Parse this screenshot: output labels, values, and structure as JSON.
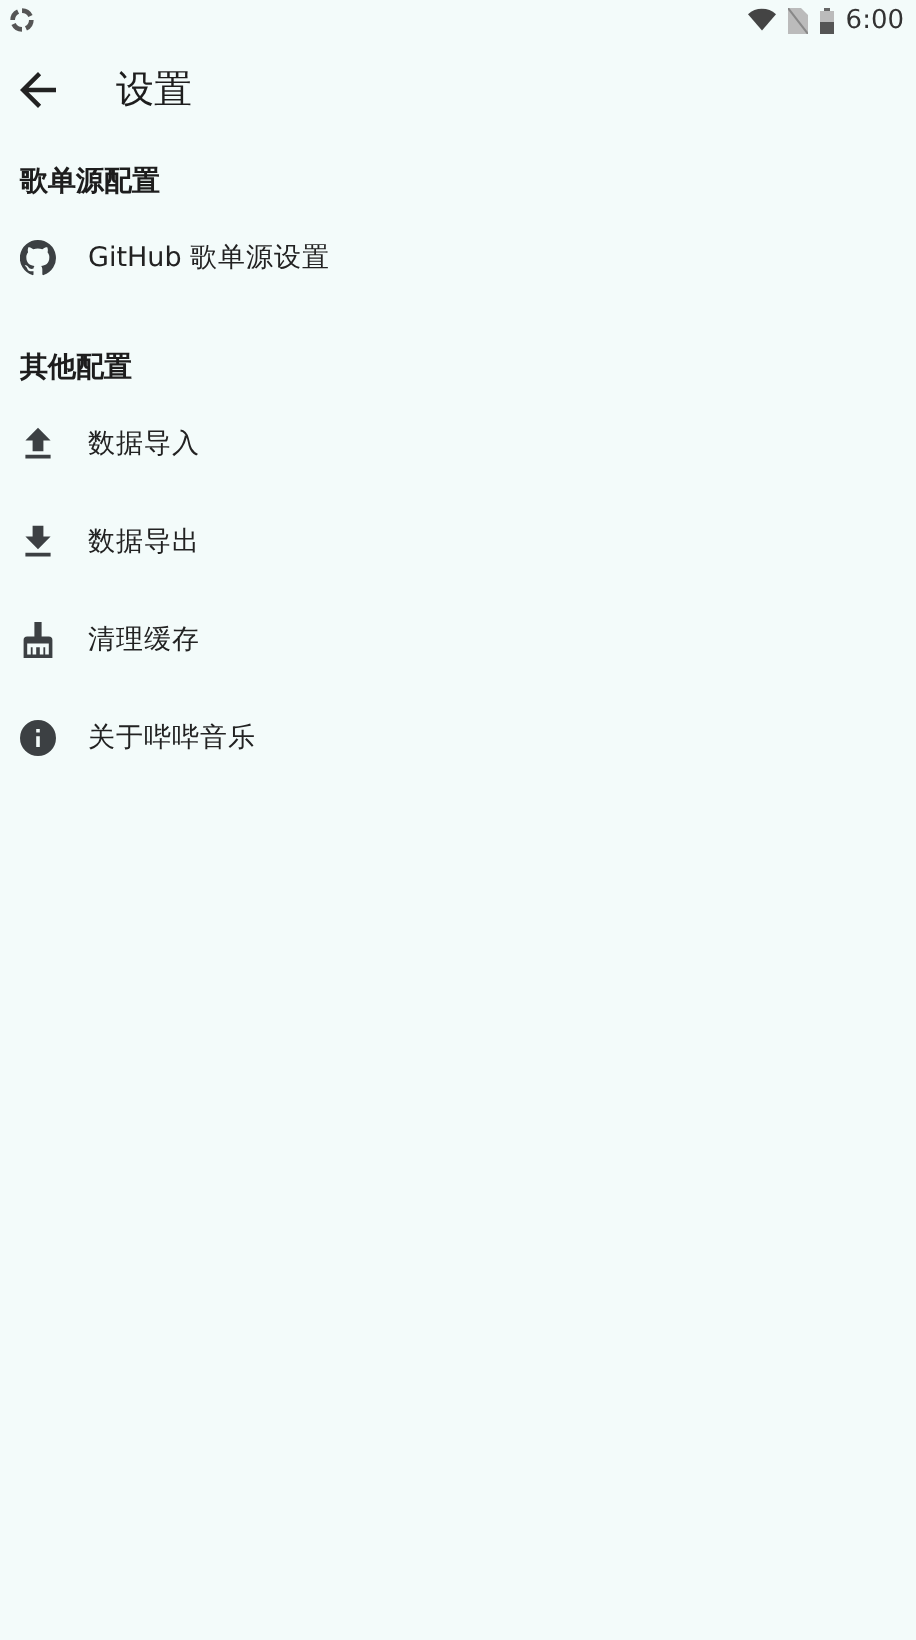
{
  "status_bar": {
    "time": "6:00"
  },
  "app_bar": {
    "title": "设置"
  },
  "sections": [
    {
      "title": "歌单源配置",
      "items": [
        {
          "label": "GitHub 歌单源设置"
        }
      ]
    },
    {
      "title": "其他配置",
      "items": [
        {
          "label": "数据导入"
        },
        {
          "label": "数据导出"
        },
        {
          "label": "清理缓存"
        },
        {
          "label": "关于哔哔音乐"
        }
      ]
    }
  ]
}
